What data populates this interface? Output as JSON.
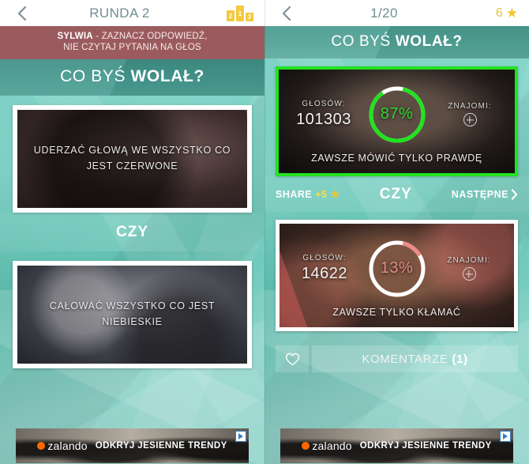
{
  "left_panel": {
    "topbar": {
      "back_icon": "chevron-left-icon",
      "title": "RUNDA 2",
      "podium_icon": {
        "second": "2",
        "first": "1",
        "third": "3"
      }
    },
    "notice": {
      "player": "SYLWIA",
      "line1_rest": " - ZAZNACZ ODPOWIEDŹ,",
      "line2": "NIE CZYTAJ PYTANIA NA GŁOS"
    },
    "question_heading": {
      "light": "CO BYŚ ",
      "bold": "WOLAŁ?"
    },
    "answers": [
      {
        "label": "UDERZAĆ GŁOWĄ WE WSZYSTKO CO JEST CZERWONE"
      },
      {
        "label": "CAŁOWAĆ WSZYSTKO CO JEST NIEBIESKIE"
      }
    ],
    "divider_label": "CZY"
  },
  "right_panel": {
    "topbar": {
      "back_icon": "chevron-left-icon",
      "title": "1/20",
      "star_count": "6",
      "star_icon": "star-icon"
    },
    "question_heading": {
      "light": "CO BYŚ ",
      "bold": "WOLAŁ?"
    },
    "results": [
      {
        "state": "winner",
        "votes_label": "GŁOSÓW:",
        "votes_value": "101303",
        "percent_label": "87%",
        "percent_value": 87,
        "friends_label": "ZNAJOMI:",
        "friends_icon": "plus-circle-icon",
        "caption": "ZAWSZE MÓWIĆ TYLKO PRAWDĘ",
        "ring_color": "#22e220",
        "ring_track": "#ffffff"
      },
      {
        "state": "loser",
        "votes_label": "GŁOSÓW:",
        "votes_value": "14622",
        "percent_label": "13%",
        "percent_value": 13,
        "friends_label": "ZNAJOMI:",
        "friends_icon": "plus-circle-icon",
        "caption": "ZAWSZE TYLKO KŁAMAĆ",
        "ring_color": "#ef8b87",
        "ring_track": "#ffffff"
      }
    ],
    "actionbar": {
      "share_label": "SHARE",
      "share_bonus": "+5",
      "share_star_icon": "star-icon",
      "middle_label": "CZY",
      "next_label": "NASTĘPNE",
      "next_icon": "chevron-right-icon"
    },
    "comments": {
      "heart_icon": "heart-outline-icon",
      "label": "KOMENTARZE",
      "count": "(1)"
    }
  },
  "ad": {
    "brand": "zalando",
    "text": "ODKRYJ JESIENNE TRENDY",
    "badge_icon": "adchoices-icon"
  },
  "colors": {
    "teal_bg": "#6fcfc0",
    "notice_red": "#9b5b5e",
    "band_teal": "#45998f",
    "win_green": "#22e220",
    "lose_pink": "#ef8b87",
    "gold": "#f3c52e",
    "topbar_text": "#6f8e92"
  }
}
